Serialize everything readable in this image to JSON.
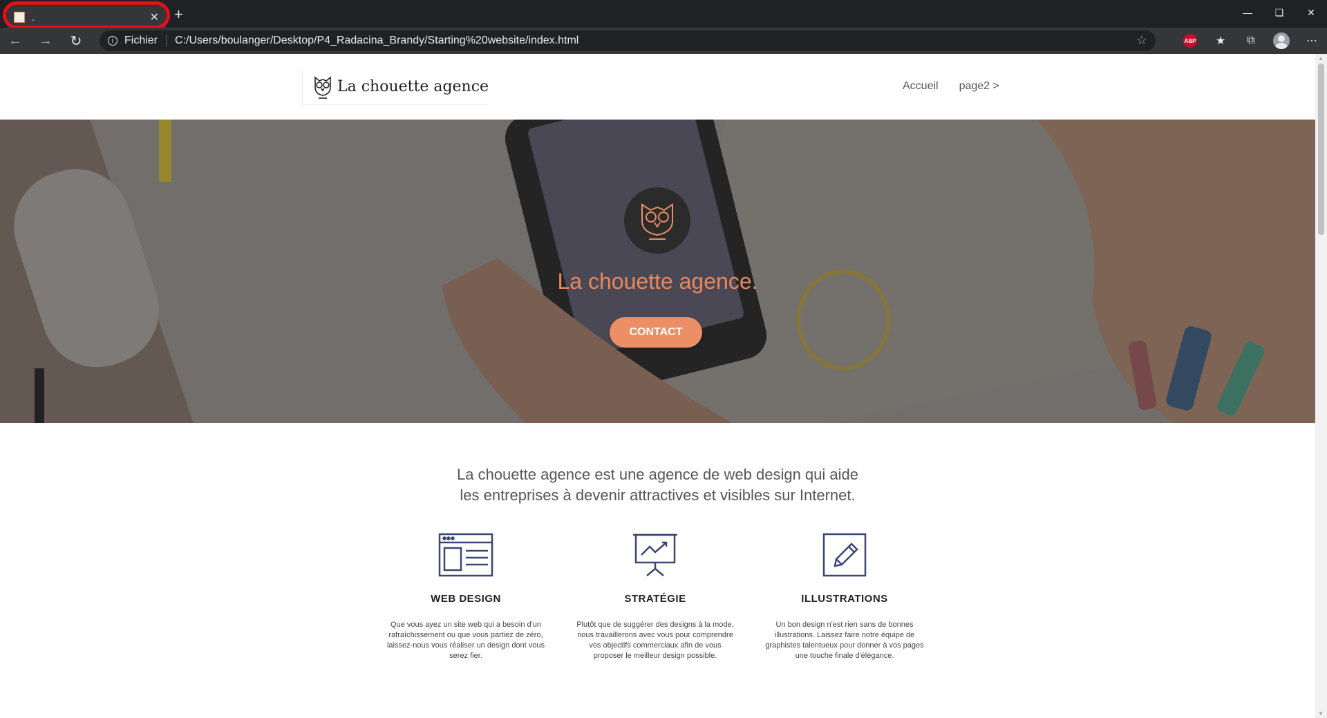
{
  "browser": {
    "tab_title": ".",
    "tab_close": "✕",
    "new_tab": "+",
    "scheme_label": "Fichier",
    "url": "C:/Users/boulanger/Desktop/P4_Radacina_Brandy/Starting%20website/index.html",
    "abp_label": "ABP",
    "highlight_color": "#e3101b"
  },
  "site": {
    "logo_text": "La chouette agence",
    "nav": [
      "Accueil",
      "page2 >"
    ],
    "hero_title": "La chouette agence.",
    "contact_label": "CONTACT",
    "intro_line1": "La chouette agence est une agence de web design qui aide",
    "intro_line2": "les entreprises à devenir attractives et visibles sur Internet.",
    "accent_color": "#ec8f66",
    "services": [
      {
        "icon": "browser-window-icon",
        "title": "WEB DESIGN",
        "text": "Que vous ayez un site web qui a besoin d'un rafraîchissement ou que vous partiez de zéro, laissez-nous vous réaliser un design dont vous serez fier."
      },
      {
        "icon": "presentation-chart-icon",
        "title": "STRATÉGIE",
        "text": "Plutôt que de suggérer des designs à la mode, nous travaillerons avec vous pour comprendre vos objectifs commerciaux afin de vous proposer le meilleur design possible."
      },
      {
        "icon": "pencil-icon",
        "title": "ILLUSTRATIONS",
        "text": "Un bon design n'est rien sans de bonnes illustrations. Laissez faire notre équipe de graphistes talentueux pour donner à vos pages une touche finale d'élégance."
      }
    ]
  }
}
